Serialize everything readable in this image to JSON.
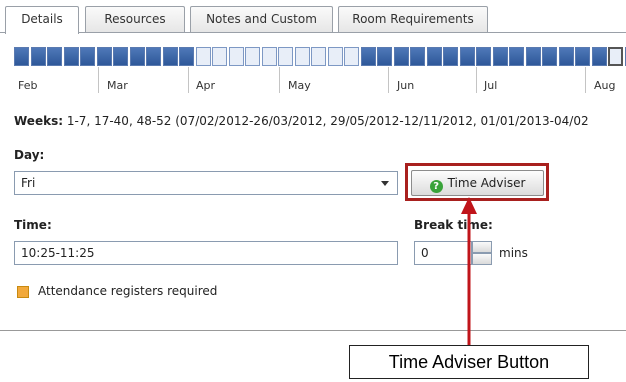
{
  "tabs": [
    "Details",
    "Resources",
    "Notes and Custom",
    "Room Requirements"
  ],
  "active_tab": "Details",
  "months": [
    "Feb",
    "Mar",
    "Apr",
    "May",
    "Jun",
    "Jul",
    "Aug"
  ],
  "weeks": {
    "label": "Weeks:",
    "value": "1-7, 17-40, 48-52 (07/02/2012-26/03/2012, 29/05/2012-12/11/2012, 01/01/2013-04/02"
  },
  "day": {
    "label": "Day:",
    "value": "Fri"
  },
  "time_adviser_button": {
    "label": "Time Adviser"
  },
  "time": {
    "label": "Time:",
    "value": "10:25-11:25"
  },
  "break_time": {
    "label": "Break time:",
    "value": "0",
    "unit": "mins"
  },
  "attendance": {
    "label": "Attendance registers required",
    "checked": true
  },
  "callout": {
    "text": "Time Adviser Button"
  },
  "colors": {
    "highlight": "#a8201e",
    "week_on": "#3a64a6",
    "week_off": "#e8eef8",
    "help_icon": "#39a33a"
  }
}
